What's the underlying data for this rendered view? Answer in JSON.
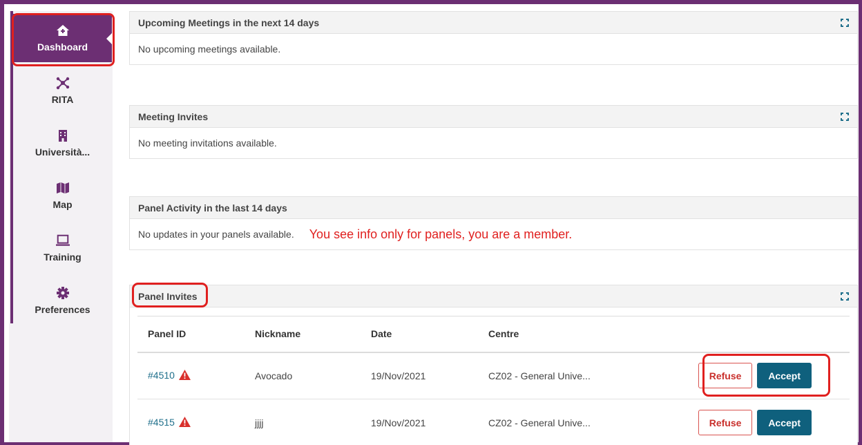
{
  "sidebar": {
    "items": [
      {
        "label": "Dashboard",
        "icon": "home-icon",
        "active": true
      },
      {
        "label": "RITA",
        "icon": "network-icon"
      },
      {
        "label": "Università...",
        "icon": "building-icon"
      },
      {
        "label": "Map",
        "icon": "map-icon"
      },
      {
        "label": "Training",
        "icon": "laptop-icon"
      },
      {
        "label": "Preferences",
        "icon": "gear-icon"
      }
    ]
  },
  "panels": {
    "upcoming": {
      "title": "Upcoming Meetings in the next 14 days",
      "empty": "No upcoming meetings available."
    },
    "invites": {
      "title": "Meeting Invites",
      "empty": "No meeting invitations available."
    },
    "activity": {
      "title": "Panel Activity in the last 14 days",
      "empty": "No updates in your panels available.",
      "annotation": "You see info only for panels, you are a member."
    },
    "panel_invites": {
      "title": "Panel Invites",
      "columns": [
        "Panel ID",
        "Nickname",
        "Date",
        "Centre"
      ],
      "rows": [
        {
          "id": "#4510",
          "nickname": "Avocado",
          "date": "19/Nov/2021",
          "centre": "CZ02 - General Unive...",
          "refuse": "Refuse",
          "accept": "Accept"
        },
        {
          "id": "#4515",
          "nickname": "jjjj",
          "date": "19/Nov/2021",
          "centre": "CZ02 - General Unive...",
          "refuse": "Refuse",
          "accept": "Accept"
        }
      ]
    }
  },
  "colors": {
    "brand": "#6c2f73",
    "accent": "#0f607d",
    "highlight": "#e0201f",
    "warning": "#d9302c"
  }
}
